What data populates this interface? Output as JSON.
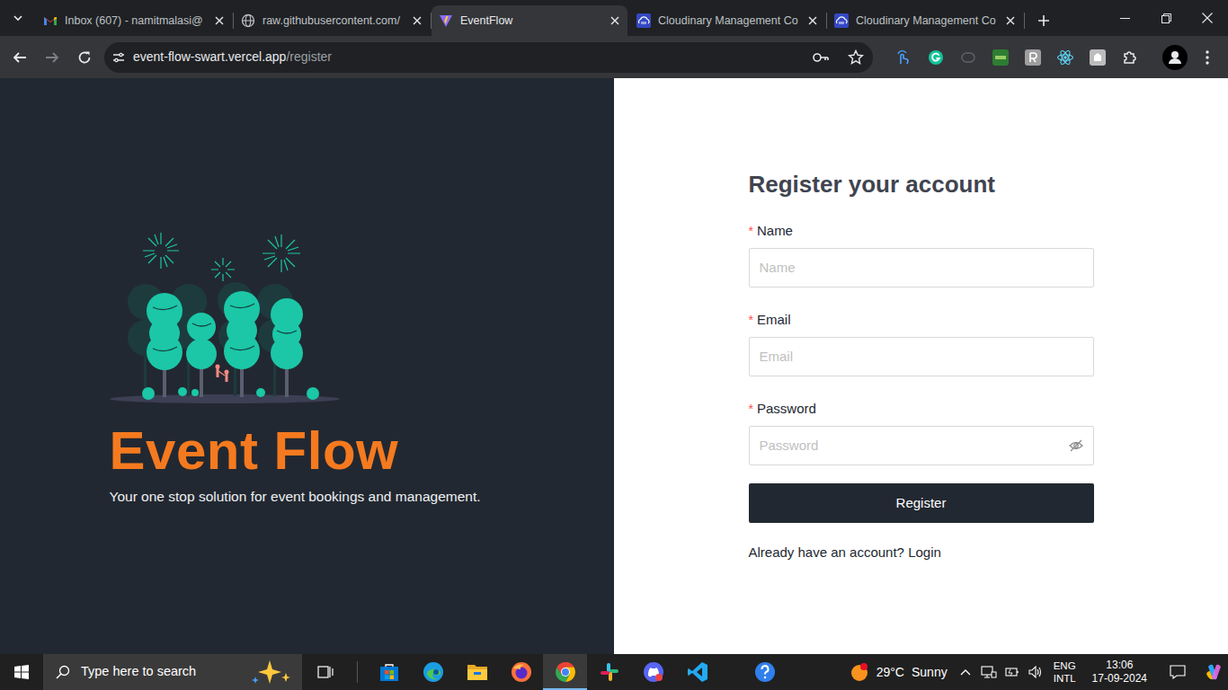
{
  "browser": {
    "tabs": [
      {
        "label": "Inbox (607) - namitmalasi@",
        "selected": false
      },
      {
        "label": "raw.githubusercontent.com/",
        "selected": false
      },
      {
        "label": "EventFlow",
        "selected": true
      },
      {
        "label": "Cloudinary Management Co",
        "selected": false
      },
      {
        "label": "Cloudinary Management Co",
        "selected": false
      }
    ],
    "address": {
      "host": "event-flow-swart.vercel.app",
      "path": "/register"
    }
  },
  "page": {
    "brand": {
      "title": "Event Flow",
      "tagline": "Your one stop solution for event bookings and management."
    },
    "form": {
      "title": "Register your account",
      "fields": [
        {
          "label": "Name",
          "required_mark": "*",
          "placeholder": "Name",
          "kind": "text"
        },
        {
          "label": "Email",
          "required_mark": "*",
          "placeholder": "Email",
          "kind": "email"
        },
        {
          "label": "Password",
          "required_mark": "*",
          "placeholder": "Password",
          "kind": "password"
        }
      ],
      "submit": "Register",
      "footer": {
        "text": "Already have an account?",
        "link": "Login"
      }
    }
  },
  "taskbar": {
    "search_placeholder": "Type here to search",
    "weather": {
      "temperature": "29°C",
      "condition": "Sunny"
    },
    "language": {
      "primary": "ENG",
      "secondary": "INTL"
    },
    "clock": {
      "time": "13:06",
      "date": "17-09-2024"
    }
  }
}
